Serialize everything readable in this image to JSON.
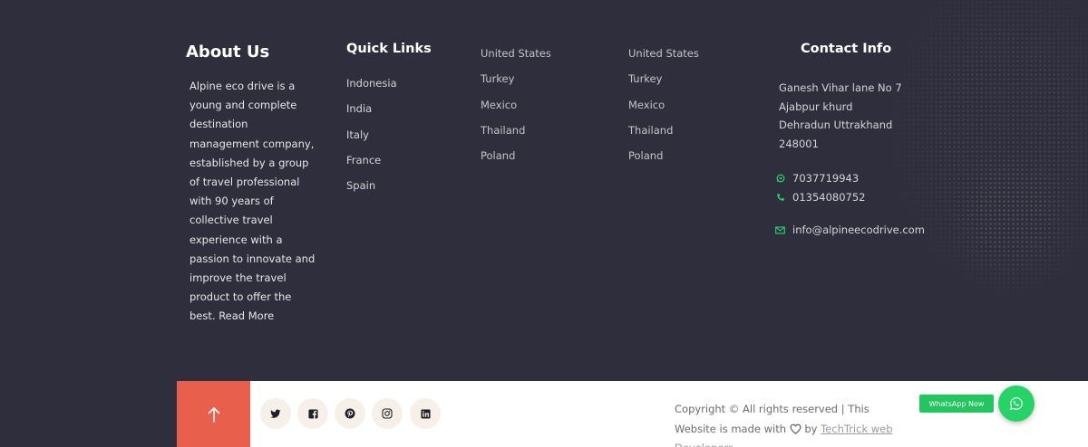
{
  "about": {
    "title": "About Us",
    "text": "Alpine eco drive is a young and complete destination management company, established by a group of travel professional with 90 years of collective travel experience with a passion to innovate and improve the travel product to offer the best.",
    "read_more": "Read More"
  },
  "quick_links": {
    "title": "Quick Links",
    "items": [
      "Indonesia",
      "India",
      "Italy",
      "France",
      "Spain"
    ]
  },
  "links_col2": [
    "United States",
    "Turkey",
    "Mexico",
    "Thailand",
    "Poland"
  ],
  "links_col3": [
    "United States",
    "Turkey",
    "Mexico",
    "Thailand",
    "Poland"
  ],
  "contact": {
    "title": "Contact Info",
    "address_lines": [
      "Ganesh Vihar lane No 7",
      "Ajabpur khurd",
      "Dehradun Uttrakhand",
      "248001"
    ],
    "phone1": "7037719943",
    "phone2": "01354080752",
    "email": "info@alpineecodrive.com"
  },
  "bottom": {
    "social_icons": [
      "twitter-icon",
      "facebook-icon",
      "pinterest-icon",
      "instagram-icon",
      "linkedin-icon"
    ],
    "copyright_prefix": "Copyright © All rights reserved | This Website is made with",
    "by": "by",
    "developer": "TechTrick web Developers",
    "whatsapp_label": "WhatsApp Now"
  },
  "colors": {
    "background": "#2e2e3c",
    "accent": "#e8604c",
    "whatsapp": "#25d366"
  }
}
